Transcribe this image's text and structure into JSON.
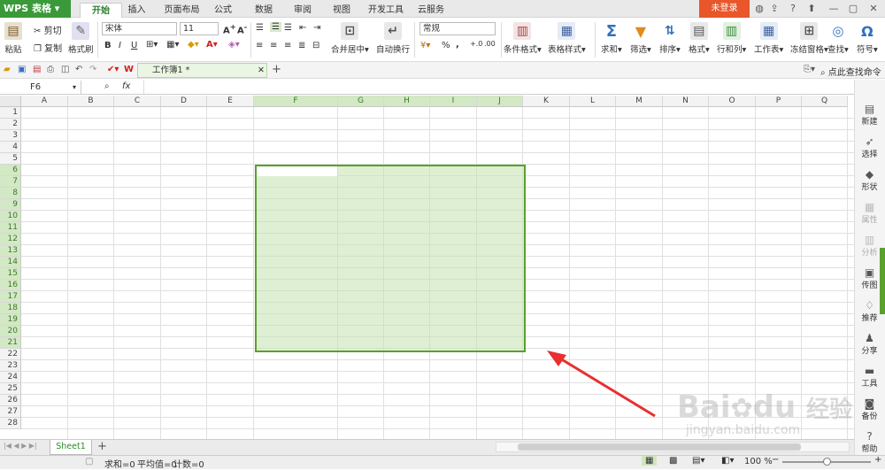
{
  "app": {
    "logo": "WPS 表格",
    "login": "未登录"
  },
  "tabs": [
    "开始",
    "插入",
    "页面布局",
    "公式",
    "数据",
    "审阅",
    "视图",
    "开发工具",
    "云服务"
  ],
  "ribbon": {
    "paste": "粘贴",
    "cut": "剪切",
    "copy": "复制",
    "format_painter": "格式刷",
    "font_name": "宋体",
    "font_size": "11",
    "bold": "B",
    "italic": "I",
    "underline": "U",
    "merge_center": "合并居中",
    "wrap_text": "自动换行",
    "number_format": "常规",
    "percent": "%",
    "comma": ",",
    "cond_format": "条件格式",
    "table_style": "表格样式",
    "sum": "求和",
    "filter": "筛选",
    "sort": "排序",
    "format": "格式",
    "row_col": "行和列",
    "worksheet": "工作表",
    "freeze": "冻结窗格",
    "find": "查找",
    "symbol": "符号"
  },
  "quick": {
    "doc_tab": "工作簿1 *",
    "search_cmd": "点此查找命令",
    "add_tab": "+"
  },
  "formula": {
    "cell_ref": "F6",
    "fx": "fx"
  },
  "grid": {
    "columns": [
      "A",
      "B",
      "C",
      "D",
      "E",
      "F",
      "G",
      "H",
      "I",
      "J",
      "K",
      "L",
      "M",
      "N",
      "O",
      "P",
      "Q"
    ],
    "rows": [
      "1",
      "2",
      "3",
      "4",
      "5",
      "6",
      "7",
      "8",
      "9",
      "10",
      "11",
      "12",
      "13",
      "14",
      "15",
      "16",
      "17",
      "18",
      "19",
      "20",
      "21",
      "22",
      "23",
      "24",
      "25",
      "26",
      "27",
      "28"
    ],
    "selected_columns": [
      "F",
      "G",
      "H",
      "I",
      "J"
    ],
    "selected_rows_from": 6,
    "selected_rows_to": 21
  },
  "side_panel": [
    {
      "label": "新建",
      "icon": "new-doc-icon",
      "glyph": "▤"
    },
    {
      "label": "选择",
      "icon": "select-icon",
      "glyph": "➶"
    },
    {
      "label": "形状",
      "icon": "shape-icon",
      "glyph": "◆"
    },
    {
      "label": "属性",
      "icon": "property-icon",
      "glyph": "▦"
    },
    {
      "label": "分析",
      "icon": "analysis-icon",
      "glyph": "▥"
    },
    {
      "label": "传图",
      "icon": "upload-image-icon",
      "glyph": "▣"
    },
    {
      "label": "推荐",
      "icon": "recommend-icon",
      "glyph": "♢"
    },
    {
      "label": "分享",
      "icon": "share-icon",
      "glyph": "♟"
    },
    {
      "label": "工具",
      "icon": "toolbox-icon",
      "glyph": "▬"
    },
    {
      "label": "备份",
      "icon": "backup-icon",
      "glyph": "◙"
    },
    {
      "label": "帮助",
      "icon": "help-icon",
      "glyph": "?"
    }
  ],
  "sheets": {
    "active": "Sheet1",
    "add": "+"
  },
  "status": {
    "sum": "求和=0",
    "average": "平均值=0",
    "count": "计数=0",
    "zoom": "100 %"
  },
  "watermark": {
    "brand": "Bai",
    "brand2": "du",
    "cn": "经验",
    "url": "jingyan.baidu.com"
  },
  "colors": {
    "accent": "#3a9a3a",
    "selection": "#5aa02c",
    "login_bg": "#e8562a",
    "arrow": "#e8302f"
  }
}
